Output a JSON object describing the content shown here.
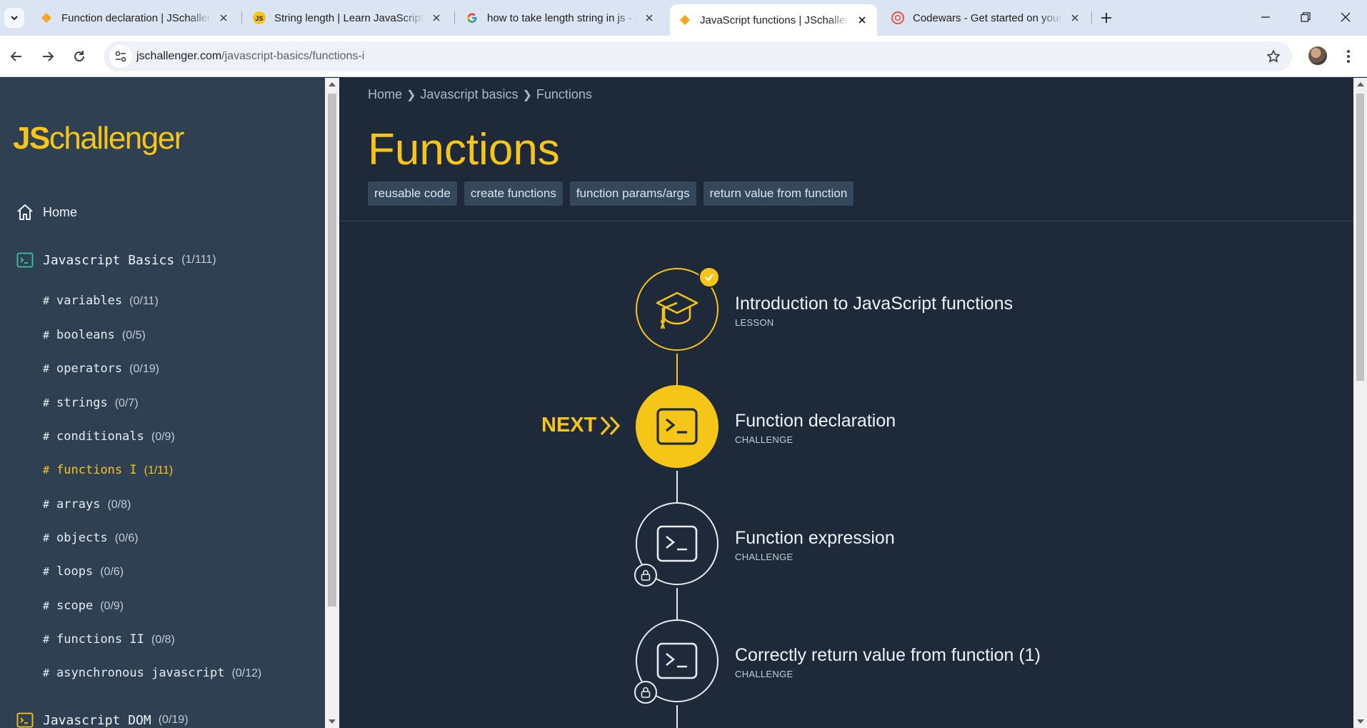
{
  "browser": {
    "tabs": [
      {
        "title": "Function declaration | JSchallenger",
        "favicon": "jschallenger-diamond",
        "active": false
      },
      {
        "title": "String length | Learn JavaScript",
        "favicon": "js-logo",
        "active": false
      },
      {
        "title": "how to take length string in js - Google Search",
        "favicon": "google-g",
        "active": false
      },
      {
        "title": "JavaScript functions | JSchallenger",
        "favicon": "jschallenger-diamond",
        "active": true
      },
      {
        "title": "Codewars - Get started on your coding journey",
        "favicon": "codewars-logo",
        "active": false
      }
    ],
    "url_host": "jschallenger.com",
    "url_path": "/javascript-basics/functions-i"
  },
  "sidebar": {
    "logo_js": "JS",
    "logo_rest": "challenger",
    "home_label": "Home",
    "sections": [
      {
        "label": "Javascript Basics",
        "count": "(1/111)"
      },
      {
        "label": "Javascript DOM",
        "count": "(0/19)"
      }
    ],
    "items": [
      {
        "label": "variables",
        "count": "(0/11)"
      },
      {
        "label": "booleans",
        "count": "(0/5)"
      },
      {
        "label": "operators",
        "count": "(0/19)"
      },
      {
        "label": "strings",
        "count": "(0/7)"
      },
      {
        "label": "conditionals",
        "count": "(0/9)"
      },
      {
        "label": "functions I",
        "count": "(1/11)",
        "active": true
      },
      {
        "label": "arrays",
        "count": "(0/8)"
      },
      {
        "label": "objects",
        "count": "(0/6)"
      },
      {
        "label": "loops",
        "count": "(0/6)"
      },
      {
        "label": "scope",
        "count": "(0/9)"
      },
      {
        "label": "functions II",
        "count": "(0/8)"
      },
      {
        "label": "asynchronous javascript",
        "count": "(0/12)"
      }
    ]
  },
  "main": {
    "breadcrumb": [
      "Home",
      "Javascript basics",
      "Functions"
    ],
    "title": "Functions",
    "tags": [
      "reusable code",
      "create functions",
      "function params/args",
      "return value from function"
    ],
    "next_label": "NEXT",
    "steps": [
      {
        "title": "Introduction to JavaScript functions",
        "type": "LESSON",
        "state": "completed",
        "icon": "graduation-cap-icon"
      },
      {
        "title": "Function declaration",
        "type": "CHALLENGE",
        "state": "next",
        "icon": "terminal-icon"
      },
      {
        "title": "Function expression",
        "type": "CHALLENGE",
        "state": "locked",
        "icon": "terminal-icon"
      },
      {
        "title": "Correctly return value from function (1)",
        "type": "CHALLENGE",
        "state": "locked",
        "icon": "terminal-icon"
      }
    ]
  },
  "colors": {
    "accent": "#f5c518",
    "sidebar_bg": "#2f4052",
    "main_bg": "#1e2a3a",
    "tag_bg": "#35475b"
  }
}
